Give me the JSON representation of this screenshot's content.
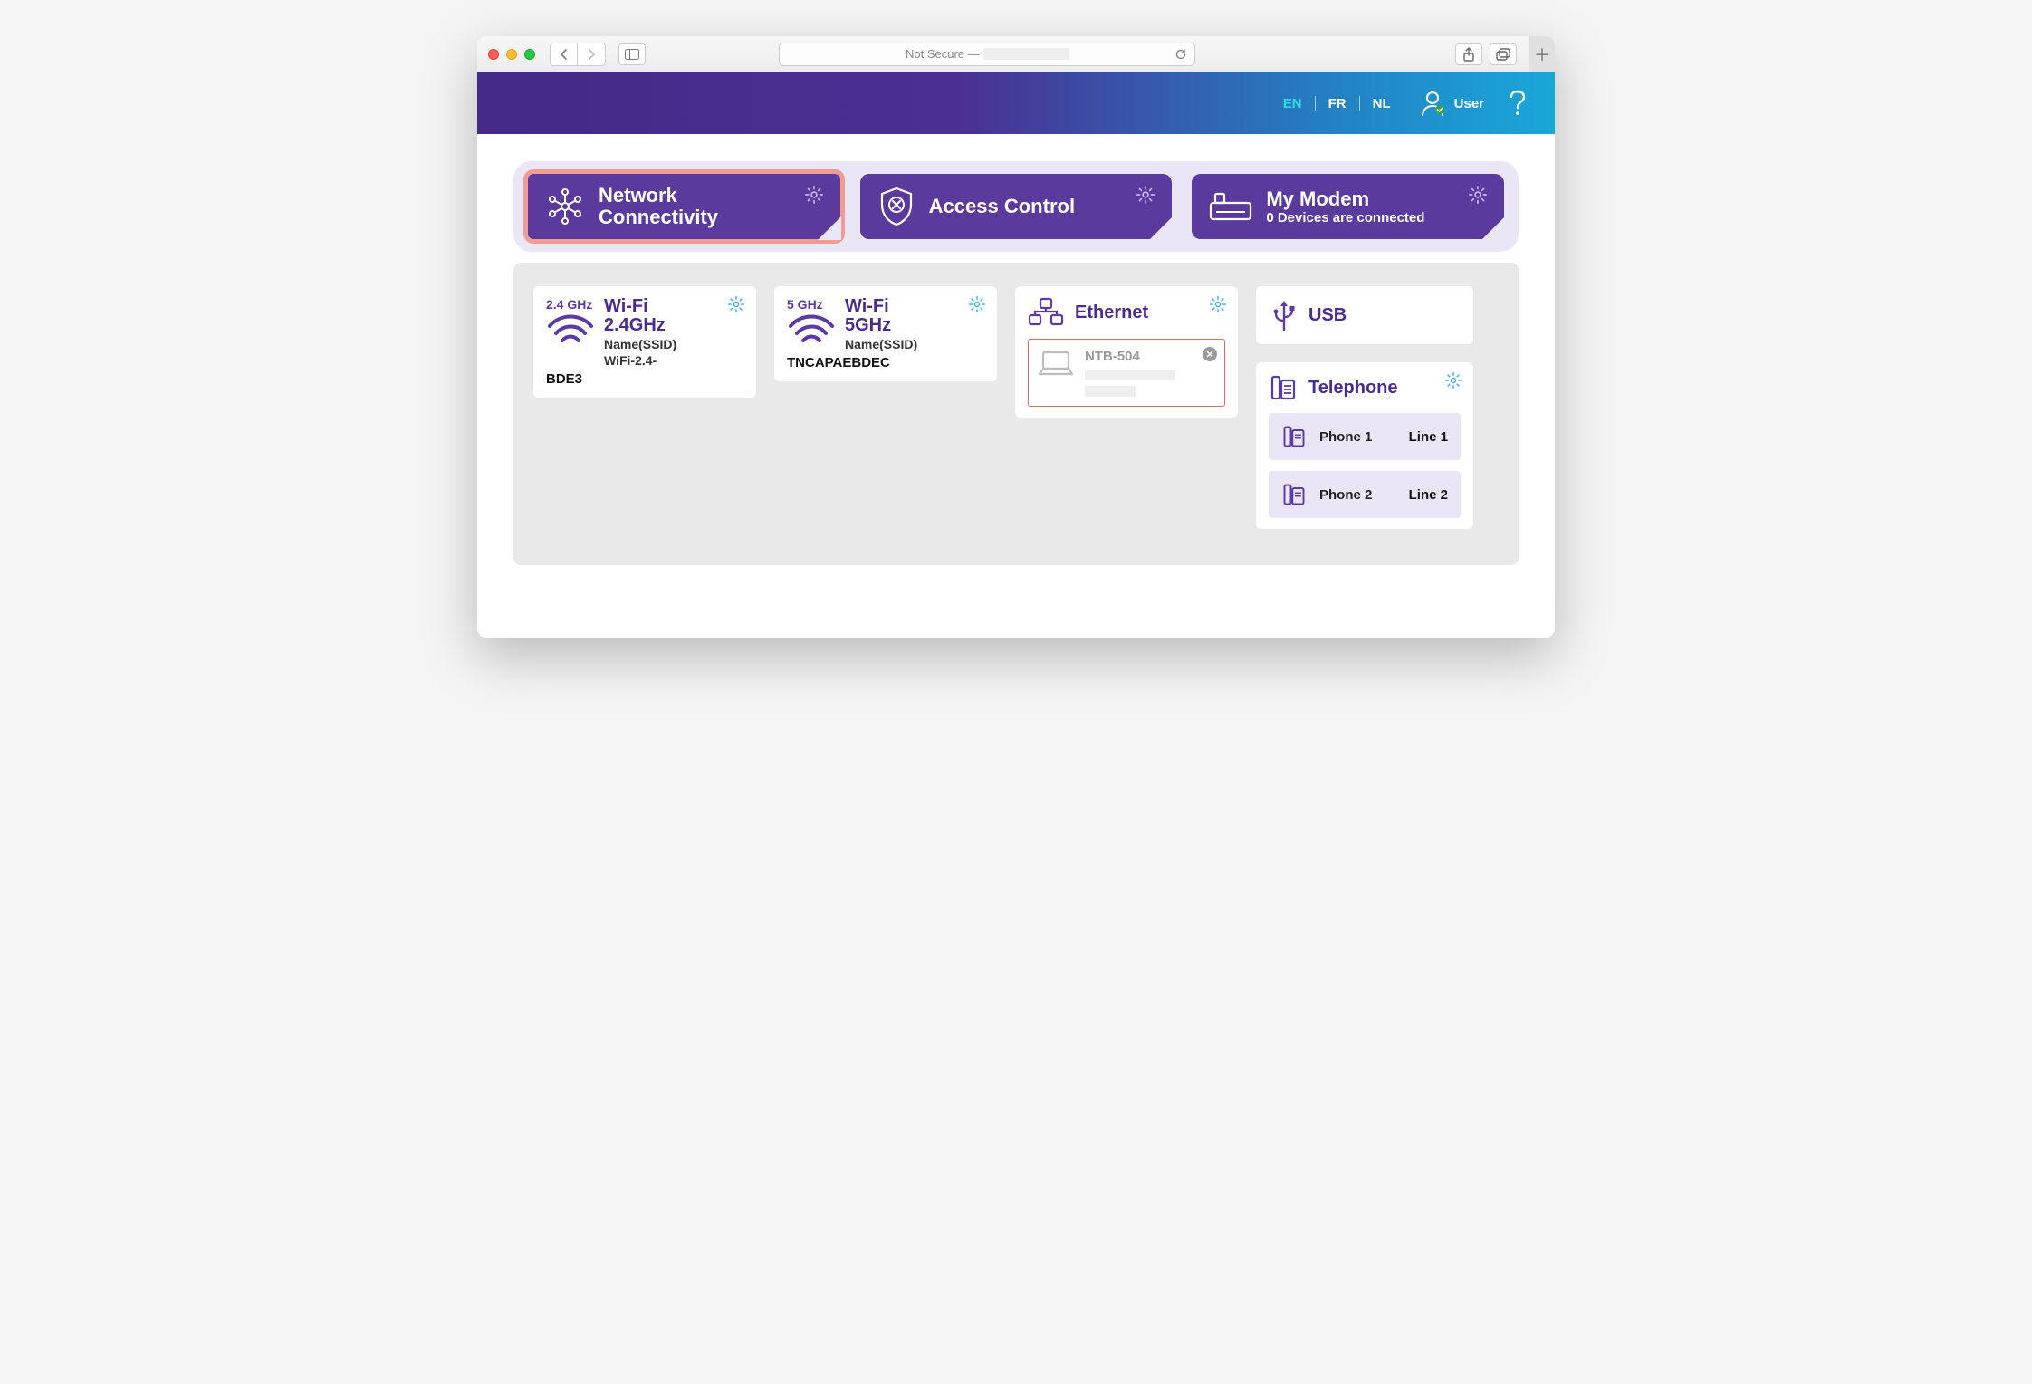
{
  "browser": {
    "url_prefix": "Not Secure —"
  },
  "header": {
    "languages": {
      "en": "EN",
      "fr": "FR",
      "nl": "NL",
      "active": "en"
    },
    "user_label": "User"
  },
  "tabs": {
    "network": {
      "title_line1": "Network",
      "title_line2": "Connectivity"
    },
    "access": {
      "title": "Access Control"
    },
    "modem": {
      "title": "My Modem",
      "subtitle": "0 Devices are connected"
    }
  },
  "wifi24": {
    "band": "2.4 GHz",
    "title_line1": "Wi-Fi",
    "title_line2": "2.4GHz",
    "ssid_label": "Name(SSID)",
    "ssid_line1": "WiFi-2.4-",
    "ssid_line2": "BDE3"
  },
  "wifi5": {
    "band": "5 GHz",
    "title_line1": "Wi-Fi",
    "title_line2": "5GHz",
    "ssid_label": "Name(SSID)",
    "ssid": "TNCAPAEBDEC"
  },
  "ethernet": {
    "title": "Ethernet",
    "device_name": "NTB-504"
  },
  "usb": {
    "title": "USB"
  },
  "telephone": {
    "title": "Telephone",
    "phones": [
      {
        "label": "Phone 1",
        "line": "Line 1"
      },
      {
        "label": "Phone 2",
        "line": "Line 2"
      }
    ]
  }
}
